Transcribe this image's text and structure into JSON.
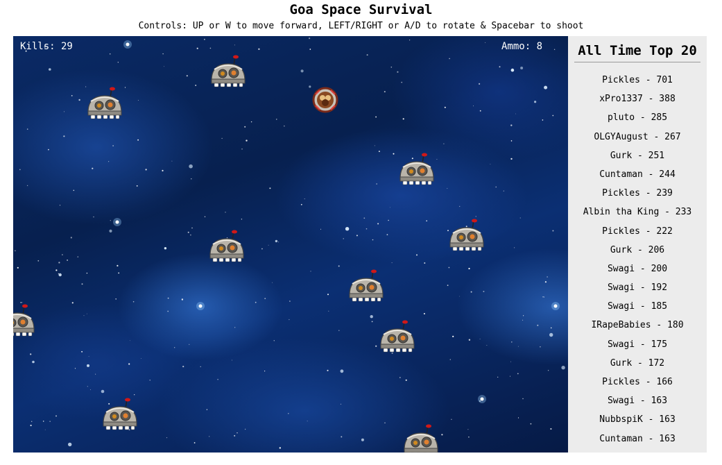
{
  "page": {
    "title": "Goa Space Survival",
    "controls": "Controls: UP or W to move forward, LEFT/RIGHT or A/D to rotate & Spacebar to shoot"
  },
  "hud": {
    "kills_text": "Kills: 29",
    "ammo_text": "Ammo: 8",
    "kills": 29,
    "ammo": 8
  },
  "sprites": {
    "enemy_icon": "alien-pod-ship-icon",
    "player_icon": "player-ship-icon"
  },
  "leaderboard": {
    "title": "All Time Top 20",
    "entries": [
      "Pickles - 701",
      "xPro1337 - 388",
      "pluto - 285",
      "OLGYAugust - 267",
      "Gurk - 251",
      "Cuntaman - 244",
      "Pickles - 239",
      "Albin tha King - 233",
      "Pickles - 222",
      "Gurk - 206",
      "Swagi - 200",
      "Swagi - 192",
      "Swagi - 185",
      "IRapeBabies - 180",
      "Swagi - 175",
      "Gurk - 172",
      "Pickles - 166",
      "Swagi - 163",
      "NubbspiK - 163",
      "Cuntaman - 163"
    ]
  },
  "colors": {
    "space_background": "#0a2a66",
    "hud_text": "#ffffff",
    "leaderboard_background": "#ececec"
  }
}
